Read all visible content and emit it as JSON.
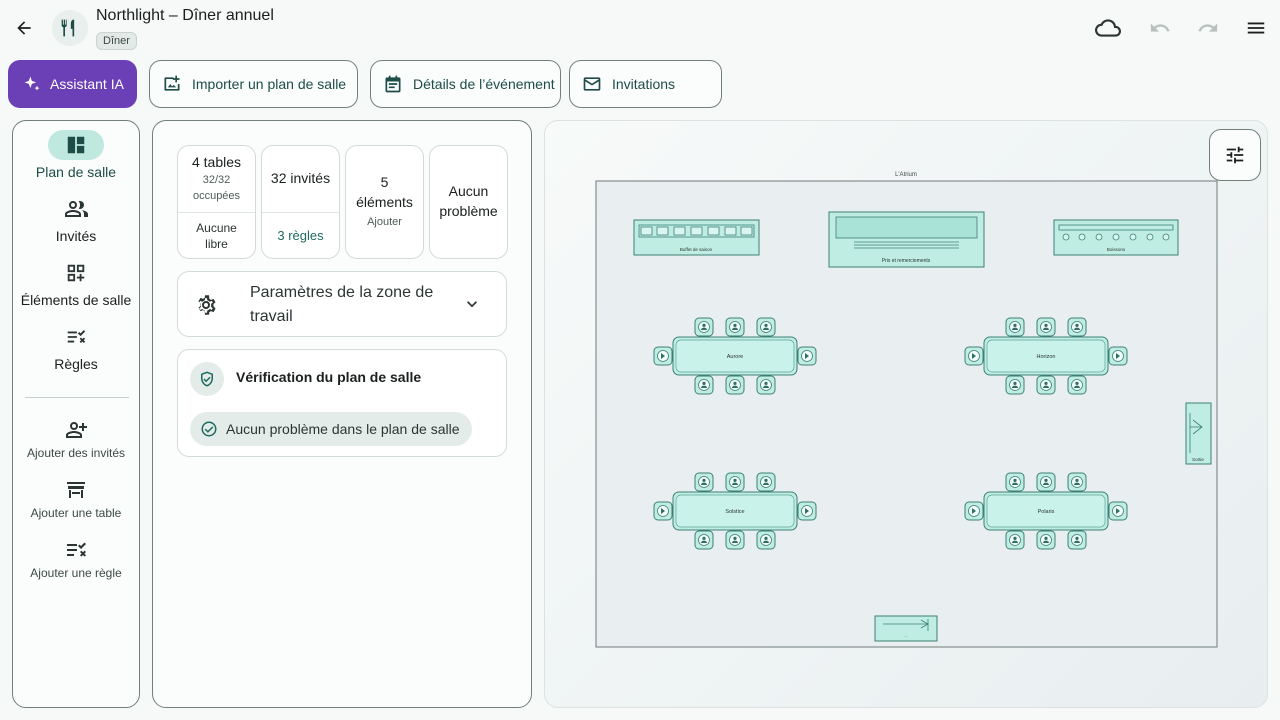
{
  "header": {
    "title": "Northlight – Dîner annuel",
    "badge": "Dîner"
  },
  "actions": {
    "ai": "Assistant IA",
    "import": "Importer un plan de salle",
    "details": "Détails de l’événement",
    "invitations": "Invitations"
  },
  "nav": {
    "items": [
      {
        "label": "Plan de salle",
        "icon": "floor-plan-icon",
        "active": true
      },
      {
        "label": "Invités",
        "icon": "people-icon"
      },
      {
        "label": "Éléments de salle",
        "icon": "add-element-icon"
      },
      {
        "label": "Règles",
        "icon": "rules-icon"
      }
    ],
    "actions": [
      {
        "label": "Ajouter des invités",
        "icon": "person-add-icon"
      },
      {
        "label": "Ajouter une table",
        "icon": "table-icon"
      },
      {
        "label": "Ajouter une règle",
        "icon": "rule-add-icon"
      }
    ]
  },
  "stats": {
    "tables": {
      "title": "4 tables",
      "sub1": "32/32",
      "sub2": "occupées",
      "bottom1": "Aucune",
      "bottom2": "libre"
    },
    "guests": {
      "title": "32 invités",
      "link": "3 règles"
    },
    "elements": {
      "title1": "5",
      "title2": "éléments",
      "sub": "Ajouter"
    },
    "problems": {
      "title1": "Aucun",
      "title2": "problème"
    }
  },
  "settings": {
    "label1": "Paramètres de la zone de",
    "label2": "travail"
  },
  "check": {
    "title": "Vérification du plan de salle",
    "status": "Aucun problème dans le plan de salle"
  },
  "floor": {
    "room_name": "L'Atrium",
    "elements": [
      {
        "label": "Buffet de saison"
      },
      {
        "label": "Prix et remerciements"
      },
      {
        "label": "Boissons"
      },
      {
        "label": "Sortie"
      },
      {
        "label": "..."
      }
    ],
    "tables": [
      {
        "name": "Aurore",
        "seats": 8
      },
      {
        "name": "Horizon",
        "seats": 8
      },
      {
        "name": "Solstice",
        "seats": 8
      },
      {
        "name": "Polaris",
        "seats": 8
      }
    ]
  },
  "colors": {
    "accent": "#6b3fb5",
    "teal": "#1d6b5f",
    "element_fill": "#bfede3",
    "element_stroke": "#3d7f74"
  }
}
